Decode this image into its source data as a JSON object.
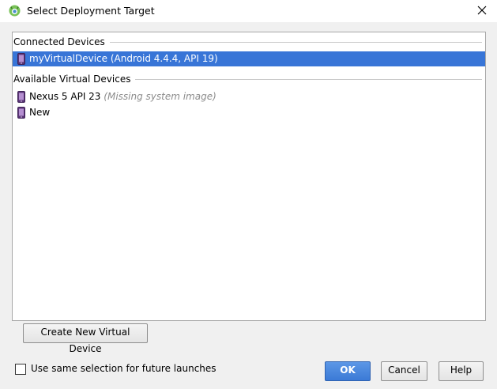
{
  "window": {
    "title": "Select Deployment Target"
  },
  "sections": {
    "connected": {
      "header": "Connected Devices",
      "devices": [
        {
          "name": "myVirtualDevice (Android 4.4.4, API 19)",
          "note": "",
          "selected": true
        }
      ]
    },
    "available": {
      "header": "Available Virtual Devices",
      "devices": [
        {
          "name": "Nexus 5 API 23",
          "note": "(Missing system image)",
          "selected": false
        },
        {
          "name": "New",
          "note": "",
          "selected": false
        }
      ]
    }
  },
  "buttons": {
    "create_new_virtual_device": "Create New Virtual Device",
    "ok": "OK",
    "cancel": "Cancel",
    "help": "Help"
  },
  "options": {
    "same_selection_label": "Use same selection for future launches",
    "same_selection_checked": false
  },
  "icons": {
    "app_logo": "android-studio-icon",
    "close": "close-icon",
    "device": "phone-icon"
  },
  "colors": {
    "selection": "#3875d7",
    "primary_button": "#3b7ad6",
    "device_icon": "#7b4fa0"
  }
}
